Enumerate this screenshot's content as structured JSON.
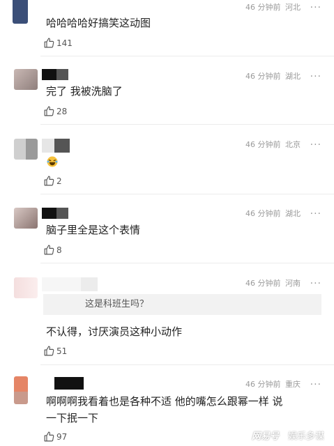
{
  "colors": {
    "meta": "#9a9a9a",
    "text": "#222222",
    "separator": "#ececec",
    "quote_bg": "#f2f2f2",
    "watermark": "#ffffff"
  },
  "comments": [
    {
      "time": "46 分钟前",
      "location": "河北",
      "text": "哈哈哈哈好搞笑这动图",
      "likes": "141",
      "avatar_icon": "blurred-avatar-icon"
    },
    {
      "time": "46 分钟前",
      "location": "湖北",
      "text": "完了 我被洗脑了",
      "likes": "28",
      "avatar_icon": "blurred-avatar-icon"
    },
    {
      "time": "46 分钟前",
      "location": "北京",
      "emoji": "laughing-tears-emoji-icon",
      "likes": "2",
      "avatar_icon": "blurred-avatar-icon"
    },
    {
      "time": "46 分钟前",
      "location": "湖北",
      "text": "脑子里全是这个表情",
      "likes": "8",
      "avatar_icon": "blurred-avatar-icon"
    },
    {
      "time": "46 分钟前",
      "location": "河南",
      "quote": "这是科班生吗？",
      "text": "不认得，讨厌演员这种小动作",
      "likes": "51",
      "avatar_icon": "blurred-avatar-icon"
    },
    {
      "time": "46 分钟前",
      "location": "重庆",
      "text_line1": "啊啊啊我看着也是各种不适 他的嘴怎么跟幂一样 说",
      "text_line2": "一下抿一下",
      "likes": "97",
      "avatar_icon": "blurred-avatar-icon"
    }
  ],
  "more_icon": "more-dots-icon",
  "like_icon": "thumbs-up-icon",
  "watermark": {
    "brand": "网易号",
    "channel": "娱乐多谋"
  }
}
